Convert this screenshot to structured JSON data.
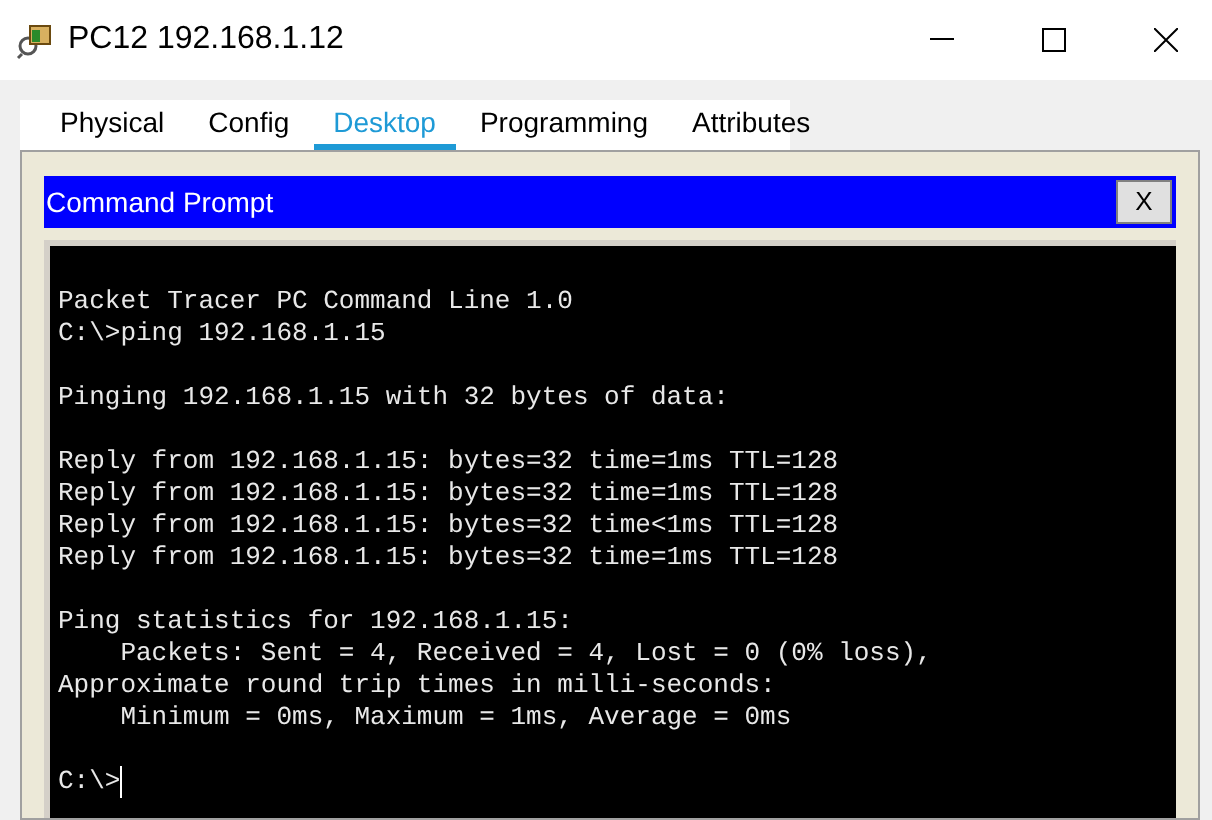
{
  "window": {
    "title": "PC12 192.168.1.12"
  },
  "tabs": [
    {
      "label": "Physical",
      "selected": false
    },
    {
      "label": "Config",
      "selected": false
    },
    {
      "label": "Desktop",
      "selected": true
    },
    {
      "label": "Programming",
      "selected": false
    },
    {
      "label": "Attributes",
      "selected": false
    }
  ],
  "command_prompt": {
    "title": "Command Prompt",
    "close_label": "X",
    "blocks": [
      [
        "Packet Tracer PC Command Line 1.0",
        "C:\\>ping 192.168.1.15"
      ],
      [
        "Pinging 192.168.1.15 with 32 bytes of data:"
      ],
      [
        "Reply from 192.168.1.15: bytes=32 time=1ms TTL=128",
        "Reply from 192.168.1.15: bytes=32 time=1ms TTL=128",
        "Reply from 192.168.1.15: bytes=32 time<1ms TTL=128",
        "Reply from 192.168.1.15: bytes=32 time=1ms TTL=128"
      ],
      [
        "Ping statistics for 192.168.1.15:",
        "    Packets: Sent = 4, Received = 4, Lost = 0 (0% loss),",
        "Approximate round trip times in milli-seconds:",
        "    Minimum = 0ms, Maximum = 1ms, Average = 0ms"
      ]
    ],
    "prompt": "C:\\>"
  }
}
